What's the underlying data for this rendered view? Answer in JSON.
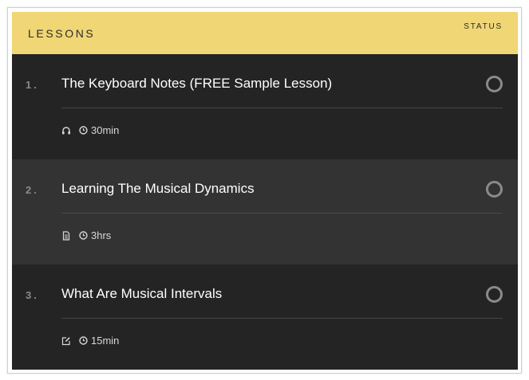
{
  "header": {
    "title": "LESSONS",
    "status_label": "STATUS"
  },
  "colors": {
    "header_bg": "#f0d674",
    "row_dark": "#242424",
    "row_light": "#333333",
    "muted": "#8a8a8a"
  },
  "lessons": [
    {
      "number": "1.",
      "title": "The Keyboard Notes (FREE Sample Lesson)",
      "type_icon": "headphones-icon",
      "duration": "30min",
      "completed": false
    },
    {
      "number": "2.",
      "title": "Learning The Musical Dynamics",
      "type_icon": "document-icon",
      "duration": "3hrs",
      "completed": false
    },
    {
      "number": "3.",
      "title": "What Are Musical Intervals",
      "type_icon": "edit-icon",
      "duration": "15min",
      "completed": false
    }
  ]
}
